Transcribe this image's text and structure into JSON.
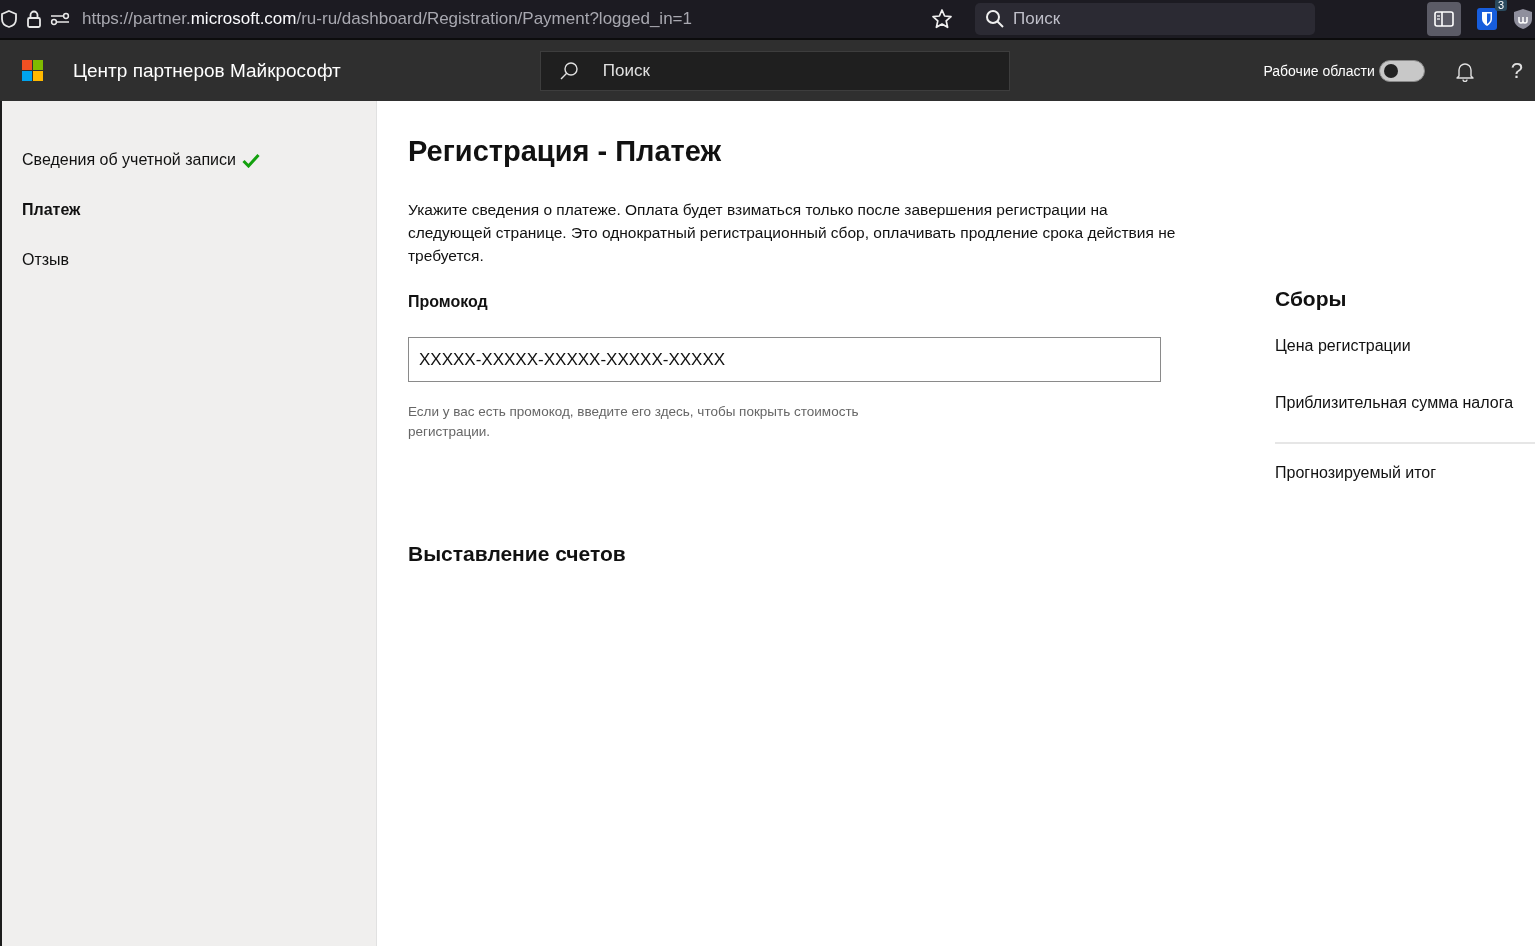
{
  "browser": {
    "url": {
      "prefix": "https://partner.",
      "domain": "microsoft.com",
      "path": "/ru-ru/dashboard/Registration/Payment?logged_in=1"
    },
    "search": {
      "placeholder": "Поиск"
    },
    "extension_badge": "3"
  },
  "header": {
    "title": "Центр партнеров Майкрософт",
    "search": {
      "placeholder": "Поиск"
    },
    "workspaces": {
      "label": "Рабочие области",
      "on": false
    },
    "help": "?"
  },
  "sidebar": {
    "items": [
      {
        "label": "Сведения об учетной записи",
        "selected": false,
        "completed": true
      },
      {
        "label": "Платеж",
        "selected": true,
        "completed": false
      },
      {
        "label": "Отзыв",
        "selected": false,
        "completed": false
      }
    ]
  },
  "page": {
    "title": "Регистрация - Платеж",
    "intro": "Укажите сведения о платеже. Оплата будет взиматься только после завершения регистрации на следующей странице. Это однократный регистрационный сбор, оплачивать продление срока действия не требуется.",
    "promo": {
      "label": "Промокод",
      "value": "XXXXX-XXXXX-XXXXX-XXXXX-XXXXX",
      "help": "Если у вас есть промокод, введите его здесь, чтобы покрыть стоимость регистрации."
    },
    "billing_heading": "Выставление счетов"
  },
  "fees": {
    "heading": "Сборы",
    "rows": [
      {
        "label": "Цена регистрации"
      },
      {
        "label": "Приблизительная сумма налога"
      }
    ],
    "total": "Прогнозируемый итог"
  }
}
